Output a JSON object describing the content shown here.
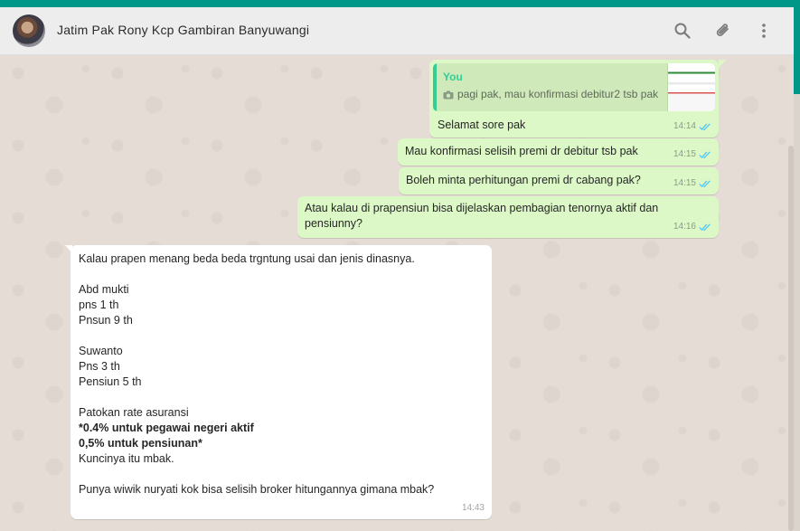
{
  "header": {
    "chat_title": "Jatim Pak Rony Kcp Gambiran Banyuwangi",
    "icons": [
      "search-icon",
      "attach-icon",
      "menu-icon"
    ]
  },
  "messages": {
    "m1": {
      "quote_author": "You",
      "quote_text": "pagi pak, mau konfirmasi debitur2 tsb pak",
      "text": "Selamat sore pak",
      "time": "14:14"
    },
    "m2": {
      "text": "Mau konfirmasi selisih premi dr debitur tsb pak",
      "time": "14:15"
    },
    "m3": {
      "text": "Boleh minta perhitungan premi dr cabang pak?",
      "time": "14:15"
    },
    "m4": {
      "text": "Atau kalau di prapensiun bisa dijelaskan pembagian tenornya aktif dan pensiunny?",
      "time": "14:16"
    },
    "m5": {
      "line1": "Kalau prapen menang beda beda  trgntung usai dan jenis dinasnya.",
      "line2": "Abd mukti",
      "line3": "pns 1 th",
      "line4": "Pnsun 9 th",
      "line5": "Suwanto",
      "line6": "Pns 3 th",
      "line7": "Pensiun 5 th",
      "line8": "Patokan rate asuransi",
      "line9": "*0.4% untuk pegawai negeri aktif",
      "line10": "0,5% untuk pensiunan*",
      "line11": "Kuncinya itu mbak.",
      "line12": "Punya wiwik nuryati kok bisa selisih broker  hitungannya gimana mbak?",
      "time": "14:43"
    }
  },
  "colors": {
    "teal": "#009688",
    "outgoing_bubble": "#dcf8c6",
    "incoming_bubble": "#ffffff",
    "read_ticks": "#4fc3f7"
  }
}
